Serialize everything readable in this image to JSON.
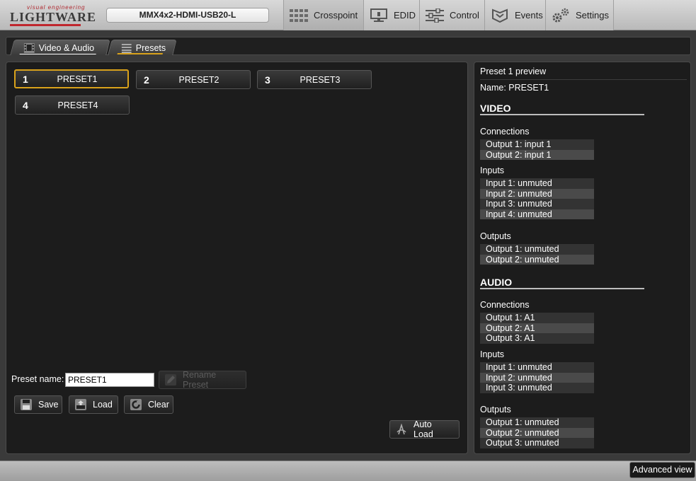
{
  "logo": {
    "tagline": "visual engineering",
    "wordmark": "LIGHTWARE"
  },
  "device": {
    "name": "MMX4x2-HDMI-USB20-L"
  },
  "nav": {
    "tabs": [
      {
        "label": "Crosspoint",
        "icon": "crosspoint-grid-icon",
        "active": true
      },
      {
        "label": "EDID",
        "icon": "monitor-icon"
      },
      {
        "label": "Control",
        "icon": "sliders-icon"
      },
      {
        "label": "Events",
        "icon": "events-icon"
      },
      {
        "label": "Settings",
        "icon": "gears-icon"
      }
    ]
  },
  "subtabs": [
    {
      "label": "Video & Audio",
      "icon": "film-icon"
    },
    {
      "label": "Presets",
      "icon": "list-icon",
      "active": true
    }
  ],
  "presets": [
    {
      "num": "1",
      "name": "PRESET1",
      "selected": true
    },
    {
      "num": "2",
      "name": "PRESET2"
    },
    {
      "num": "3",
      "name": "PRESET3"
    },
    {
      "num": "4",
      "name": "PRESET4"
    }
  ],
  "preset_form": {
    "label": "Preset name:",
    "value": "PRESET1",
    "rename_label": "Rename Preset",
    "save_label": "Save",
    "load_label": "Load",
    "clear_label": "Clear",
    "autoload_label": "Auto Load"
  },
  "preview": {
    "title": "Preset 1 preview",
    "name_line": "Name: PRESET1",
    "video": {
      "heading": "VIDEO",
      "connections_label": "Connections",
      "connections": [
        "Output 1: input 1",
        "Output 2: input 1"
      ],
      "inputs_label": "Inputs",
      "inputs": [
        "Input 1: unmuted",
        "Input 2: unmuted",
        "Input 3: unmuted",
        "Input 4: unmuted"
      ],
      "outputs_label": "Outputs",
      "outputs": [
        "Output 1: unmuted",
        "Output 2: unmuted"
      ]
    },
    "audio": {
      "heading": "AUDIO",
      "connections_label": "Connections",
      "connections": [
        "Output 1: A1",
        "Output 2: A1",
        "Output 3: A1"
      ],
      "inputs_label": "Inputs",
      "inputs": [
        "Input 1: unmuted",
        "Input 2: unmuted",
        "Input 3: unmuted"
      ],
      "outputs_label": "Outputs",
      "outputs": [
        "Output 1: unmuted",
        "Output 2: unmuted",
        "Output 3: unmuted"
      ]
    }
  },
  "footer": {
    "advanced_label": "Advanced view"
  },
  "colors": {
    "accent": "#d9a21b",
    "brand_red": "#c0272d"
  }
}
